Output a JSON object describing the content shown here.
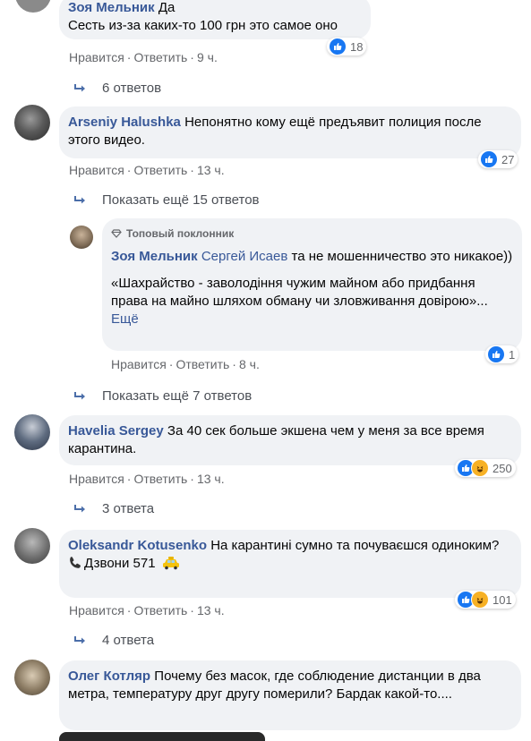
{
  "comments": [
    {
      "name": "Зоя Мельник",
      "text": "Да\nСесть из-за каких-то 100 грн это самое оно",
      "reactions": "18",
      "like": "Нравится",
      "reply": "Ответить",
      "time": "9 ч."
    },
    {
      "name": "Arseniy Halushka",
      "text": "Непонятно кому ещё предъявит полиция после этого видео.",
      "reactions": "27",
      "like": "Нравится",
      "reply": "Ответить",
      "time": "13 ч."
    },
    {
      "name": "Зоя Мельник",
      "badge": "Топовый поклонник",
      "mention": "Сергей Исаев",
      "text": "та не мошенничество это никакое))",
      "quote": "«Шахрайство - заволодіння чужим майном або придбання права на майно шляхом обману чи зловживання довірою»...",
      "more": "Ещё",
      "reactions": "1",
      "like": "Нравится",
      "reply": "Ответить",
      "time": "8 ч."
    },
    {
      "name": "Havelia Sergey",
      "text": "За 40 сек больше экшена чем у меня за все время карантина.",
      "reactions": "250",
      "like": "Нравится",
      "reply": "Ответить",
      "time": "13 ч."
    },
    {
      "name": "Oleksandr Kotusenko",
      "text": "На карантині сумно та почуваєшся одиноким?",
      "text2": "Дзвони 571",
      "reactions": "101",
      "like": "Нравится",
      "reply": "Ответить",
      "time": "13 ч."
    },
    {
      "name": "Олег Котляр",
      "text": "Почему без масок, где соблюдение дистанции в два метра, температуру друг другу померили? Бардак какой-то...."
    }
  ],
  "reply_links": {
    "r1": "6 ответов",
    "r2": "Показать ещё 15 ответов",
    "r3": "Показать ещё 7 ответов",
    "r4": "3 ответа",
    "r5": "4 ответа"
  },
  "colors": {
    "link": "#385898",
    "bubble": "#f0f2f5",
    "like": "#1877f2",
    "haha": "#f7b125",
    "meta": "#65676b"
  },
  "icons": [
    "like-reaction-icon",
    "haha-reaction-icon",
    "reply-arrow-icon",
    "diamond-icon",
    "telephone-icon",
    "taxi-icon"
  ]
}
